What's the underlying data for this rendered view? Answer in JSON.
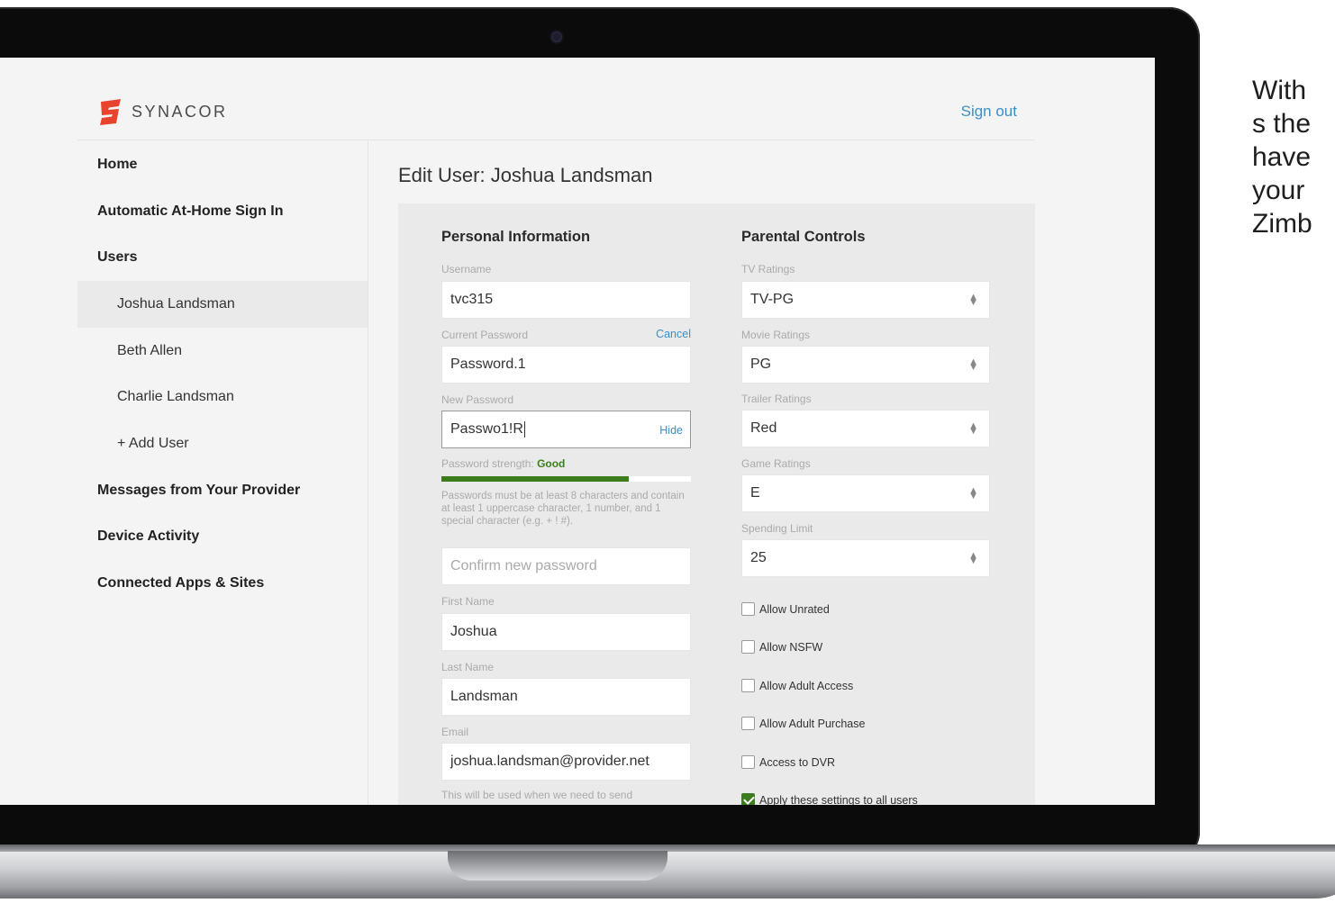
{
  "brand": {
    "name": "SYNACOR"
  },
  "header": {
    "signout_label": "Sign out"
  },
  "sidebar": {
    "items": [
      {
        "label": "Home"
      },
      {
        "label": "Automatic At-Home Sign In"
      },
      {
        "label": "Users"
      },
      {
        "label": "Joshua Landsman"
      },
      {
        "label": "Beth Allen"
      },
      {
        "label": "Charlie Landsman"
      },
      {
        "label": "+ Add User"
      },
      {
        "label": "Messages from Your Provider"
      },
      {
        "label": "Device Activity"
      },
      {
        "label": "Connected Apps & Sites"
      }
    ],
    "active": "Joshua Landsman"
  },
  "page": {
    "title": "Edit User: Joshua Landsman"
  },
  "personal": {
    "section_title": "Personal Information",
    "username_label": "Username",
    "username_value": "tvc315",
    "current_password_label": "Current Password",
    "cancel_label": "Cancel",
    "current_password_value": "Password.1",
    "new_password_label": "New Password",
    "new_password_value": "Passwo1!R",
    "hide_label": "Hide",
    "strength_label": "Password strength:",
    "strength_value": "Good",
    "strength_fraction": 0.75,
    "hint": "Passwords must be at least 8 characters and contain at least 1 uppercase character, 1 number, and 1 special character (e.g. + ! #).",
    "confirm_placeholder": "Confirm new password",
    "first_name_label": "First Name",
    "first_name_value": "Joshua",
    "last_name_label": "Last Name",
    "last_name_value": "Landsman",
    "email_label": "Email",
    "email_value": "joshua.landsman@provider.net",
    "email_note": "This will be used when we need to send"
  },
  "parental": {
    "section_title": "Parental Controls",
    "tv_label": "TV Ratings",
    "tv_value": "TV-PG",
    "movie_label": "Movie Ratings",
    "movie_value": "PG",
    "trailer_label": "Trailer Ratings",
    "trailer_value": "Red",
    "game_label": "Game Ratings",
    "game_value": "E",
    "spending_label": "Spending Limit",
    "spending_value": "25",
    "checkboxes": [
      {
        "label": "Allow Unrated",
        "checked": false
      },
      {
        "label": "Allow NSFW",
        "checked": false
      },
      {
        "label": "Allow Adult Access",
        "checked": false
      },
      {
        "label": "Allow Adult Purchase",
        "checked": false
      },
      {
        "label": "Access to DVR",
        "checked": false
      },
      {
        "label": "Apply these settings to all users",
        "checked": true
      }
    ]
  },
  "side_text": [
    "With",
    "s the",
    "have",
    "your",
    "Zimb"
  ],
  "colors": {
    "accent": "#3a8fc5",
    "success": "#3b7d1d",
    "logo": "#e8432e"
  }
}
